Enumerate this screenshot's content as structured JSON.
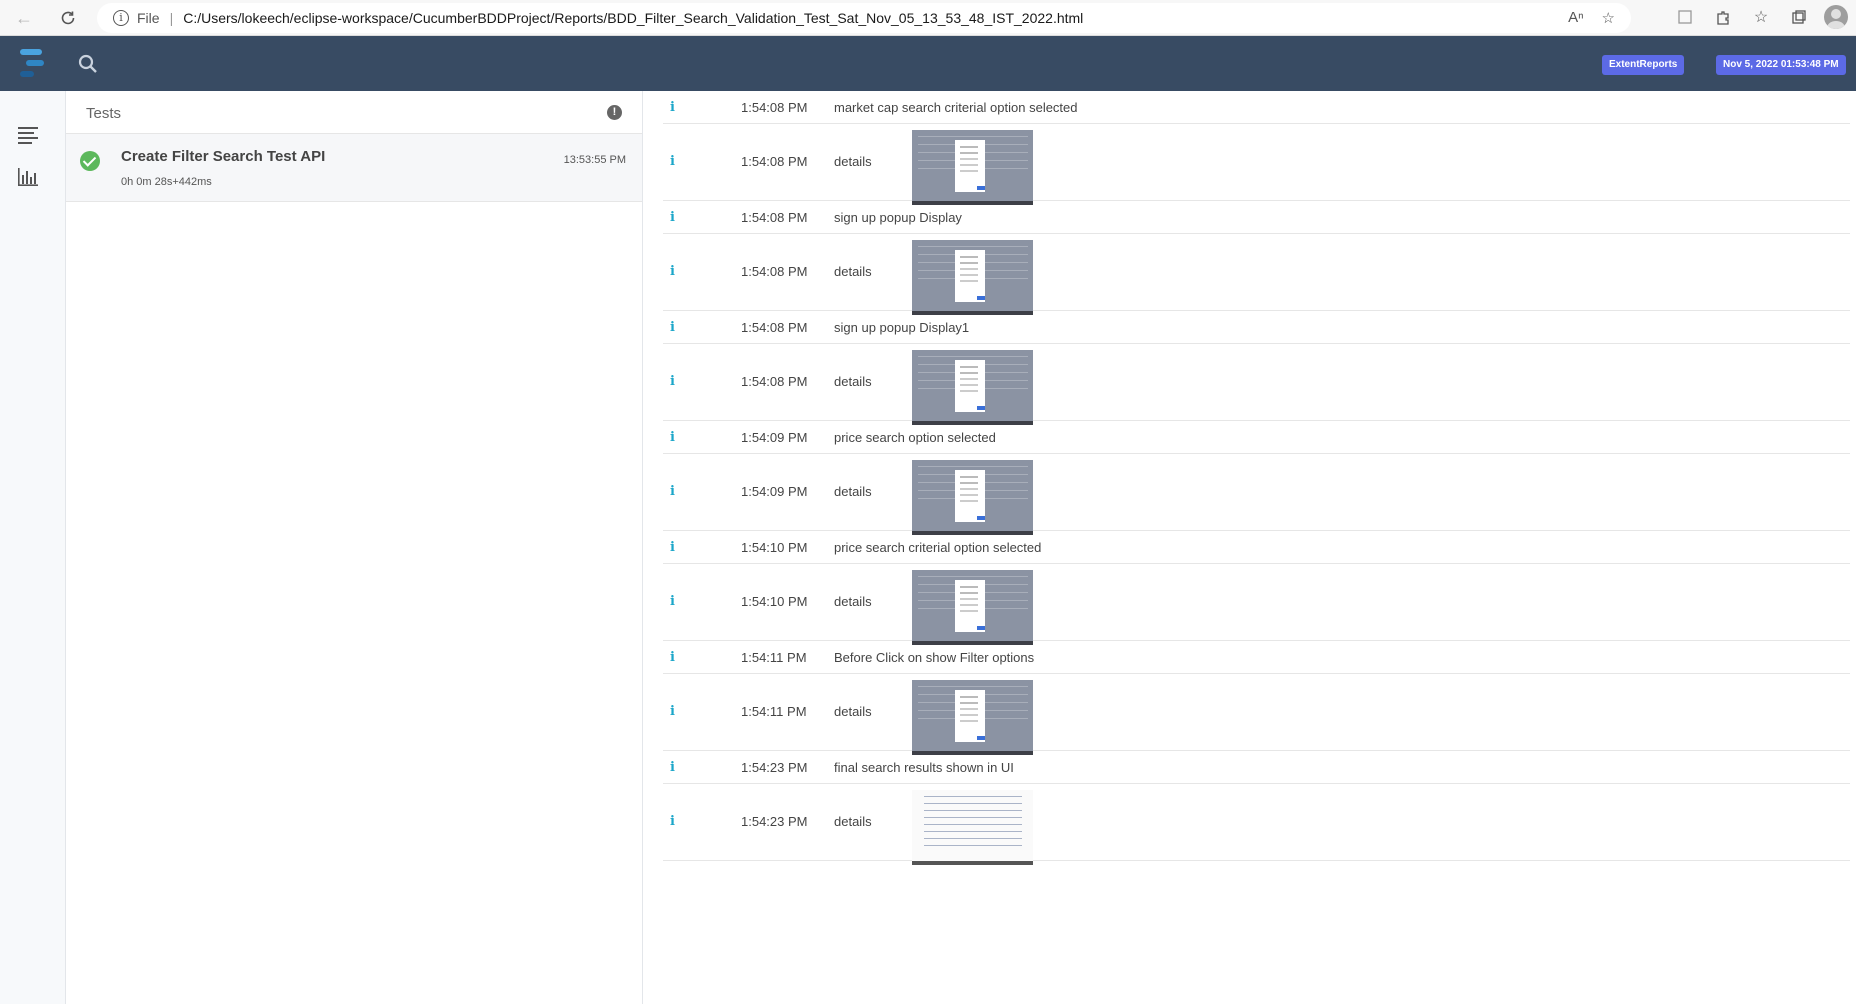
{
  "browser": {
    "scheme": "File",
    "url": "C:/Users/lokeech/eclipse-workspace/CucumberBDDProject/Reports/BDD_Filter_Search_Validation_Test_Sat_Nov_05_13_53_48_IST_2022.html"
  },
  "header": {
    "brand_badge": "ExtentReports",
    "date_badge": "Nov 5, 2022 01:53:48 PM"
  },
  "tests_panel": {
    "title": "Tests",
    "tests": [
      {
        "name": "Create Filter Search Test API",
        "duration": "0h 0m 28s+442ms",
        "start_time": "13:53:55 PM",
        "status": "pass"
      }
    ]
  },
  "log": {
    "rows": [
      {
        "icon": "i",
        "time": "1:54:08 PM",
        "text": "market cap search criterial option selected",
        "kind": "text"
      },
      {
        "icon": "i",
        "time": "1:54:08 PM",
        "text": "details",
        "kind": "img"
      },
      {
        "icon": "i",
        "time": "1:54:08 PM",
        "text": "sign up popup Display",
        "kind": "text"
      },
      {
        "icon": "i",
        "time": "1:54:08 PM",
        "text": "details",
        "kind": "img"
      },
      {
        "icon": "i",
        "time": "1:54:08 PM",
        "text": "sign up popup Display1",
        "kind": "text"
      },
      {
        "icon": "i",
        "time": "1:54:08 PM",
        "text": "details",
        "kind": "img"
      },
      {
        "icon": "i",
        "time": "1:54:09 PM",
        "text": "price search option selected",
        "kind": "text"
      },
      {
        "icon": "i",
        "time": "1:54:09 PM",
        "text": "details",
        "kind": "img"
      },
      {
        "icon": "i",
        "time": "1:54:10 PM",
        "text": "price search criterial option selected",
        "kind": "text"
      },
      {
        "icon": "i",
        "time": "1:54:10 PM",
        "text": "details",
        "kind": "img"
      },
      {
        "icon": "i",
        "time": "1:54:11 PM",
        "text": "Before Click on show Filter options",
        "kind": "text"
      },
      {
        "icon": "i",
        "time": "1:54:11 PM",
        "text": "details",
        "kind": "img"
      },
      {
        "icon": "i",
        "time": "1:54:23 PM",
        "text": "final search results shown in UI",
        "kind": "text"
      },
      {
        "icon": "i",
        "time": "1:54:23 PM",
        "text": "details",
        "kind": "img",
        "thumb_style": "light"
      }
    ]
  },
  "colors": {
    "header_bg": "#384b63",
    "badge_bg": "#5c6ae6",
    "info_icon": "#1ba6c9",
    "pass": "#5cb85c"
  }
}
